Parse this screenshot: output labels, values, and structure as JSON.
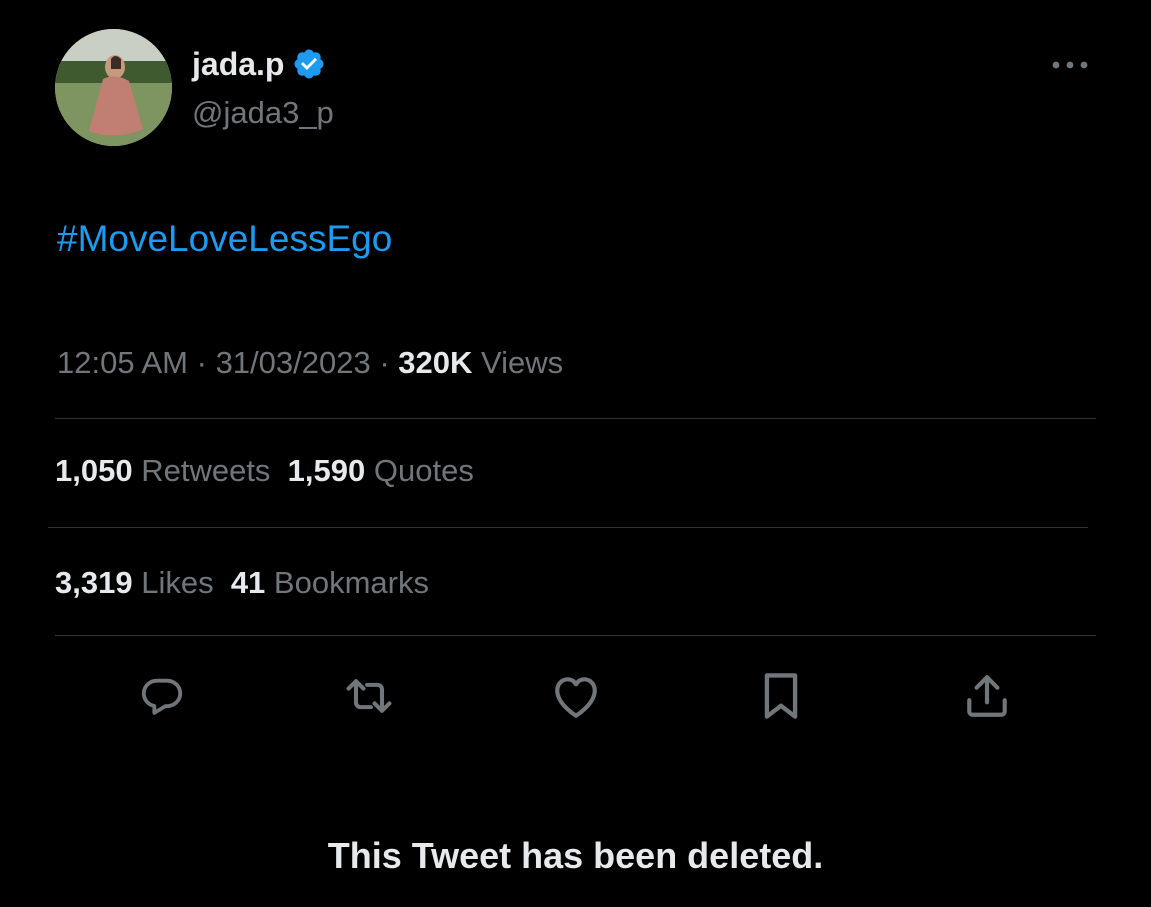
{
  "colors": {
    "background": "#000000",
    "text_primary": "#e7e9ea",
    "text_secondary": "#71767b",
    "accent": "#1d9bf0",
    "divider": "#2f3336"
  },
  "author": {
    "display_name": "jada.p",
    "handle": "@jada3_p",
    "verified": true,
    "avatar_icon": "profile-photo"
  },
  "tweet": {
    "text": "#MoveLoveLessEgo",
    "time": "12:05 AM",
    "separator": "·",
    "date": "31/03/2023",
    "views_count": "320K",
    "views_label": "Views"
  },
  "stats": {
    "retweets_count": "1,050",
    "retweets_label": "Retweets",
    "quotes_count": "1,590",
    "quotes_label": "Quotes",
    "likes_count": "3,319",
    "likes_label": "Likes",
    "bookmarks_count": "41",
    "bookmarks_label": "Bookmarks"
  },
  "actions": [
    {
      "icon": "reply-icon"
    },
    {
      "icon": "retweet-icon"
    },
    {
      "icon": "like-icon"
    },
    {
      "icon": "bookmark-icon"
    },
    {
      "icon": "share-icon"
    }
  ],
  "status_message": "This Tweet has been deleted."
}
